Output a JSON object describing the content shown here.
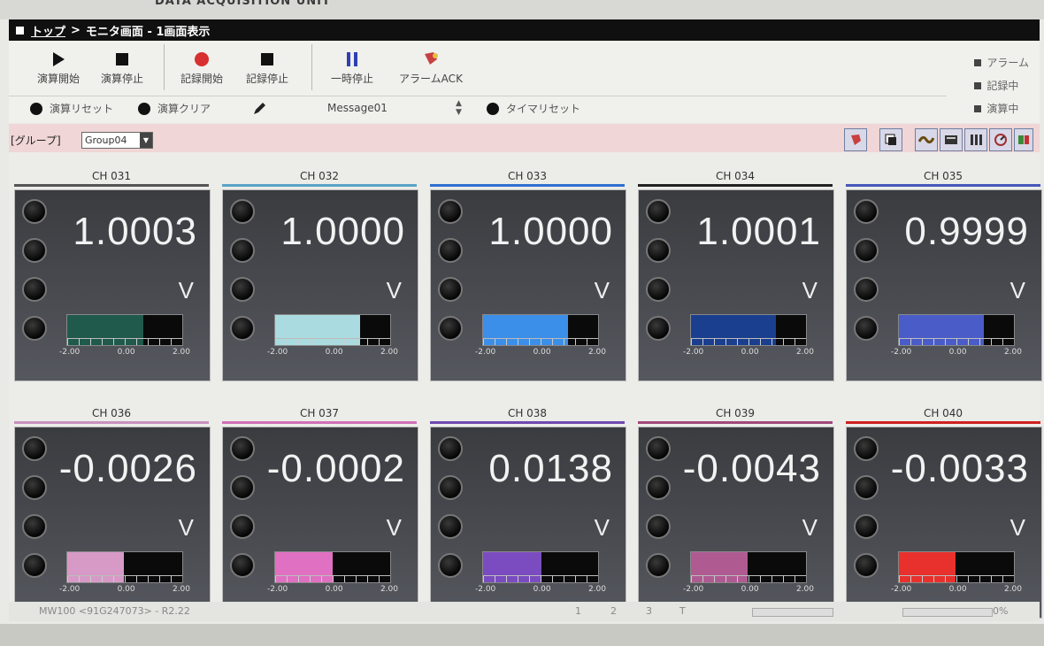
{
  "header": {
    "unit_title": "DATA ACQUISITION UNIT"
  },
  "titlebar": {
    "crumb_link": "トップ",
    "sep": ">",
    "page": "モニタ画面 - 1画面表示"
  },
  "toolbar": {
    "buttons": [
      {
        "label": "演算開始",
        "icon": "play-icon"
      },
      {
        "label": "演算停止",
        "icon": "stop-icon"
      },
      {
        "label": "記録開始",
        "icon": "record-icon"
      },
      {
        "label": "記録停止",
        "icon": "stop-icon"
      },
      {
        "label": "一時停止",
        "icon": "pause-icon"
      },
      {
        "label": "アラームACK",
        "icon": "alarm-ack-icon"
      }
    ],
    "row2": {
      "reset": "演算リセット",
      "clear": "演算クリア",
      "message": "Message01",
      "timer_reset": "タイマリセット"
    },
    "indicators": [
      "アラーム",
      "記録中",
      "演算中"
    ]
  },
  "group": {
    "label": "[グループ]",
    "selected": "Group04"
  },
  "channels": [
    {
      "name": "CH 031",
      "value": "1.0003",
      "unit": "V",
      "color": "#1f5a4c",
      "fill": 0.66
    },
    {
      "name": "CH 032",
      "value": "1.0000",
      "unit": "V",
      "color": "#a9dbe0",
      "fill": 0.74
    },
    {
      "name": "CH 033",
      "value": "1.0000",
      "unit": "V",
      "color": "#3b8fe8",
      "fill": 0.74
    },
    {
      "name": "CH 034",
      "value": "1.0001",
      "unit": "V",
      "color": "#1a3f8f",
      "fill": 0.74
    },
    {
      "name": "CH 035",
      "value": "0.9999",
      "unit": "V",
      "color": "#4a5cc8",
      "fill": 0.74
    },
    {
      "name": "CH 036",
      "value": "-0.0026",
      "unit": "V",
      "color": "#d79ac6",
      "fill": 0.49
    },
    {
      "name": "CH 037",
      "value": "-0.0002",
      "unit": "V",
      "color": "#e070c2",
      "fill": 0.5
    },
    {
      "name": "CH 038",
      "value": "0.0138",
      "unit": "V",
      "color": "#7a4cc0",
      "fill": 0.51
    },
    {
      "name": "CH 039",
      "value": "-0.0043",
      "unit": "V",
      "color": "#b05a92",
      "fill": 0.49
    },
    {
      "name": "CH 040",
      "value": "-0.0033",
      "unit": "V",
      "color": "#e8302c",
      "fill": 0.49
    }
  ],
  "scale": {
    "min": "-2.00",
    "mid": "0.00",
    "max": "2.00"
  },
  "line_colors": [
    "#555555",
    "#5aa4c8",
    "#2f6fd0",
    "#222222",
    "#4658b8",
    "#c890c0",
    "#d070b8",
    "#7048b0",
    "#a04878",
    "#d02020"
  ],
  "status": {
    "left": "MW100 <91G247073> - R2.22",
    "pages": [
      "1",
      "2",
      "3",
      "T"
    ],
    "right": "0%"
  }
}
